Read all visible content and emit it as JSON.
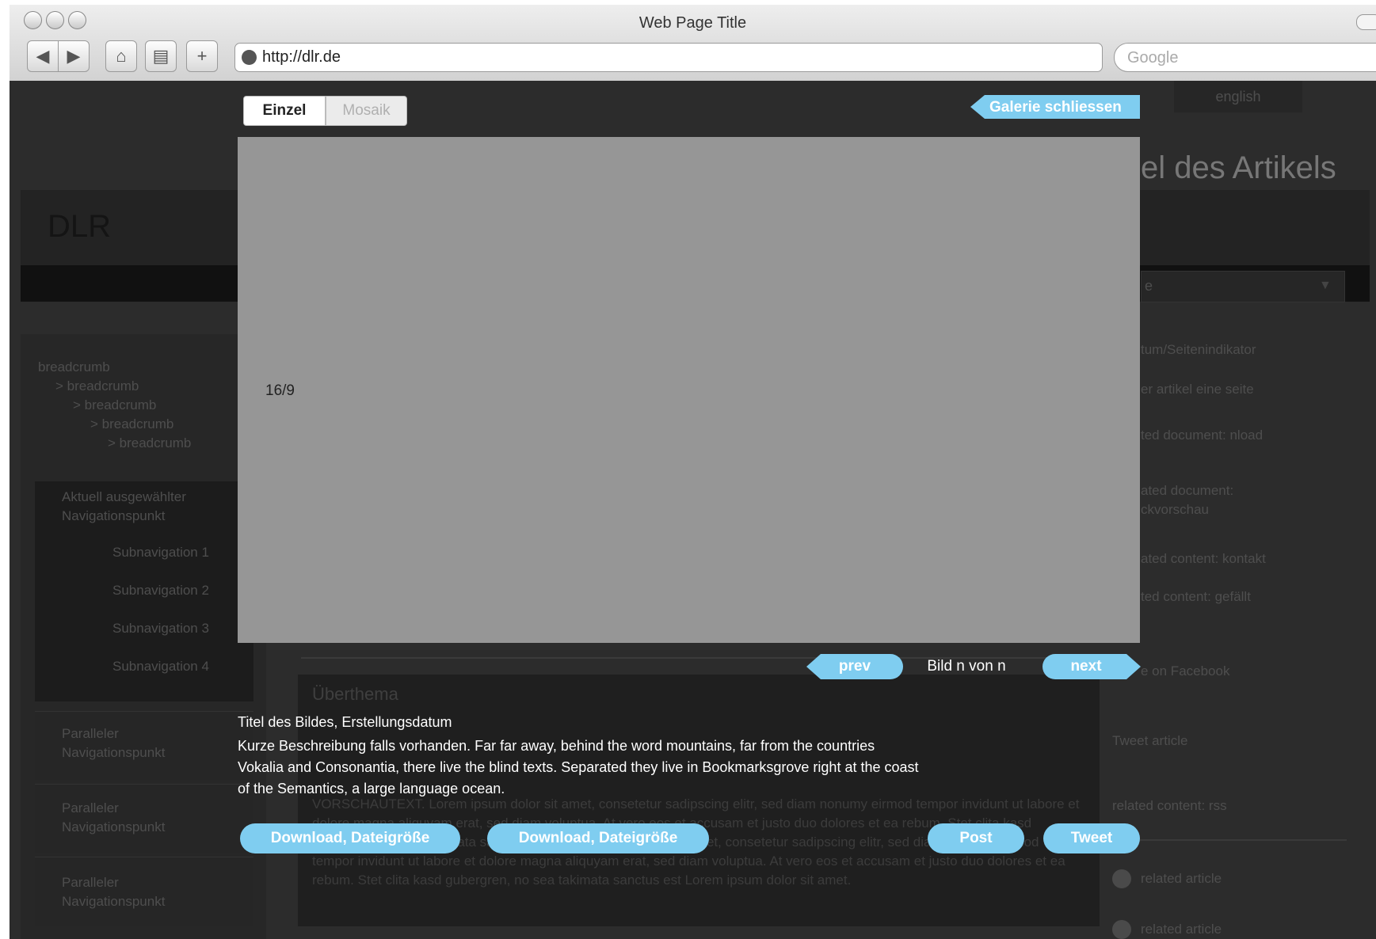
{
  "browser": {
    "title": "Web Page Title",
    "url": "http://dlr.de",
    "search_placeholder": "Google"
  },
  "site": {
    "logo": "DLR",
    "language": "english",
    "article_title_fragment": "el des Artikels",
    "breadcrumbs": [
      "breadcrumb",
      "> breadcrumb",
      "> breadcrumb",
      "> breadcrumb",
      "> breadcrumb"
    ],
    "active_nav": "Aktuell ausgewählter Navigationspunkt",
    "subnav": [
      "Subnavigation 1",
      "Subnavigation 2",
      "Subnavigation 3",
      "Subnavigation 4"
    ],
    "parallel_nav": [
      "Paralleler Navigationspunkt",
      "Paralleler Navigationspunkt",
      "Paralleler Navigationspunkt"
    ],
    "right_items": [
      "tum/Seitenindikator",
      "er artikel eine seite",
      "ted document: nload",
      "ated document: ckvorschau",
      "ated content: kontakt",
      "ted content: gefällt",
      "e on Facebook",
      "Tweet article",
      "related content: rss",
      "related article",
      "related article"
    ],
    "dropdown_fragment": "e",
    "teaser_heading": "Überthema",
    "teaser_text": "VORSCHAUTEXT. Lorem ipsum dolor sit amet, consetetur sadipscing elitr, sed diam nonumy eirmod tempor invidunt ut labore et dolore magna aliquyam erat, sed diam voluptua. At vero eos et accusam et justo duo dolores et ea rebum. Stet clita kasd gubergren, no sea takimata sanctus est. Lorem ipsum dolor sit amet, consetetur sadipscing elitr, sed diam nonumy eirmod tempor invidunt ut labore et dolore magna aliquyam erat, sed diam voluptua. At vero eos et accusam et justo duo dolores et ea rebum. Stet clita kasd gubergren, no sea takimata sanctus est Lorem ipsum dolor sit amet."
  },
  "gallery": {
    "tabs": [
      "Einzel",
      "Mosaik"
    ],
    "close_label": "Galerie schliessen",
    "aspect_label": "16/9",
    "prev_label": "prev",
    "next_label": "next",
    "counter": "Bild n von n",
    "caption_title": "Titel des Bildes, Erstellungsdatum",
    "caption_text": "Kurze Beschreibung falls vorhanden. Far far away, behind the word mountains, far from the countries Vokalia and Consonantia, there live the blind texts. Separated they live in Bookmarksgrove right at the coast of the Semantics, a large language ocean.",
    "download_1": "Download, Dateigröße",
    "download_2": "Download, Dateigröße",
    "post_label": "Post",
    "tweet_label": "Tweet"
  },
  "colors": {
    "accent": "#7fcdf0",
    "overlay_bg": "#2c2c2c",
    "image_placeholder": "#969696"
  }
}
